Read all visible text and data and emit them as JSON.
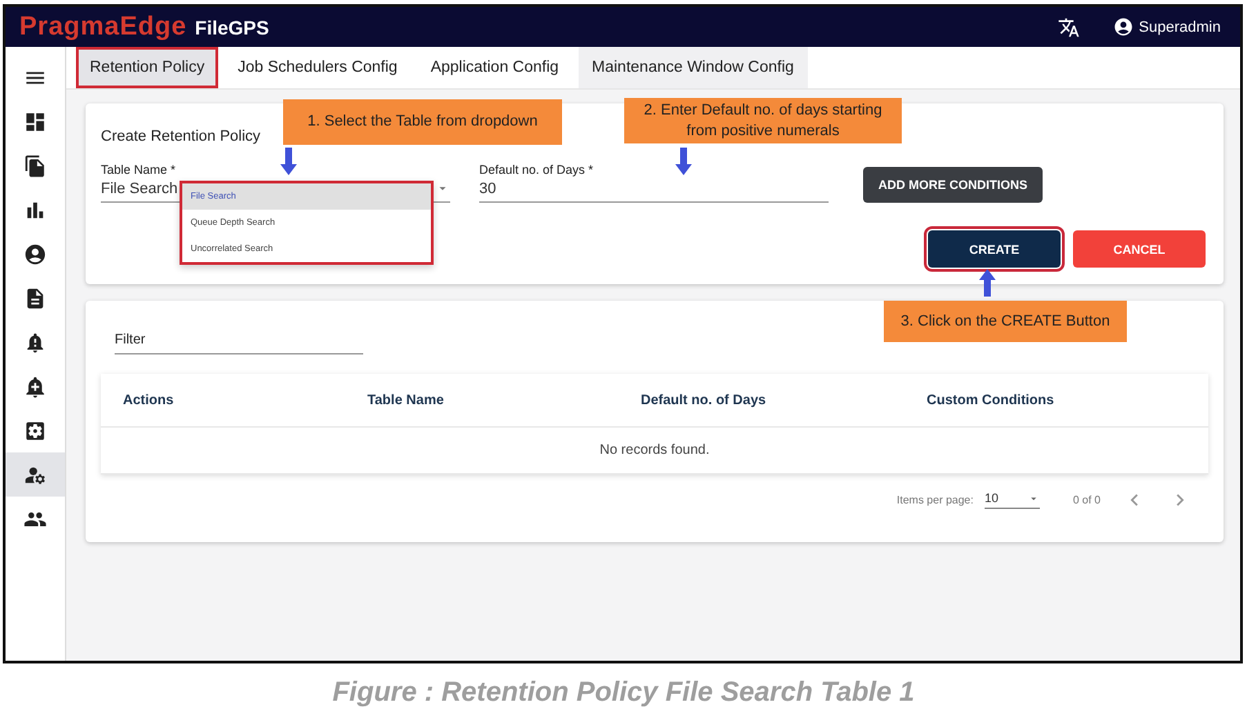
{
  "header": {
    "brand": "PragmaEdge",
    "product": "FileGPS",
    "user": "Superadmin"
  },
  "sidebar": {
    "items": [
      {
        "selected": false
      },
      {
        "selected": false
      },
      {
        "selected": false
      },
      {
        "selected": false
      },
      {
        "selected": false
      },
      {
        "selected": false
      },
      {
        "selected": false
      },
      {
        "selected": false
      },
      {
        "selected": true
      },
      {
        "selected": false
      }
    ]
  },
  "tabs": [
    {
      "label": "Retention Policy",
      "selected": true,
      "highlighted": true,
      "hovered": false
    },
    {
      "label": "Job Schedulers Config",
      "selected": false,
      "highlighted": false,
      "hovered": false
    },
    {
      "label": "Application Config",
      "selected": false,
      "highlighted": false,
      "hovered": false
    },
    {
      "label": "Maintenance Window Config",
      "selected": false,
      "highlighted": false,
      "hovered": true
    }
  ],
  "form": {
    "title": "Create Retention Policy",
    "table_name": {
      "label": "Table Name *",
      "value": "File Search",
      "dropdown_highlighted": true,
      "options": [
        {
          "label": "File Search",
          "selected": true
        },
        {
          "label": "Queue Depth Search",
          "selected": false
        },
        {
          "label": "Uncorrelated Search",
          "selected": false
        }
      ]
    },
    "days": {
      "label": "Default no. of Days *",
      "value": "30"
    },
    "add_button": "ADD MORE CONDITIONS",
    "buttons": [
      {
        "label": "CREATE",
        "kind": "primary",
        "highlighted": true
      },
      {
        "label": "CANCEL",
        "kind": "danger",
        "highlighted": false
      }
    ]
  },
  "callouts": [
    "1. Select the Table from dropdown",
    "2. Enter Default no. of days starting from positive numerals",
    "3. Click on the CREATE Button"
  ],
  "table": {
    "filter_placeholder": "Filter",
    "columns": [
      "Actions",
      "Table Name",
      "Default no. of Days",
      "Custom Conditions"
    ],
    "empty_message": "No records found.",
    "items_per_page_label": "Items per page:",
    "items_per_page": "10",
    "range": "0 of 0"
  },
  "caption": "Figure : Retention Policy File Search Table 1"
}
